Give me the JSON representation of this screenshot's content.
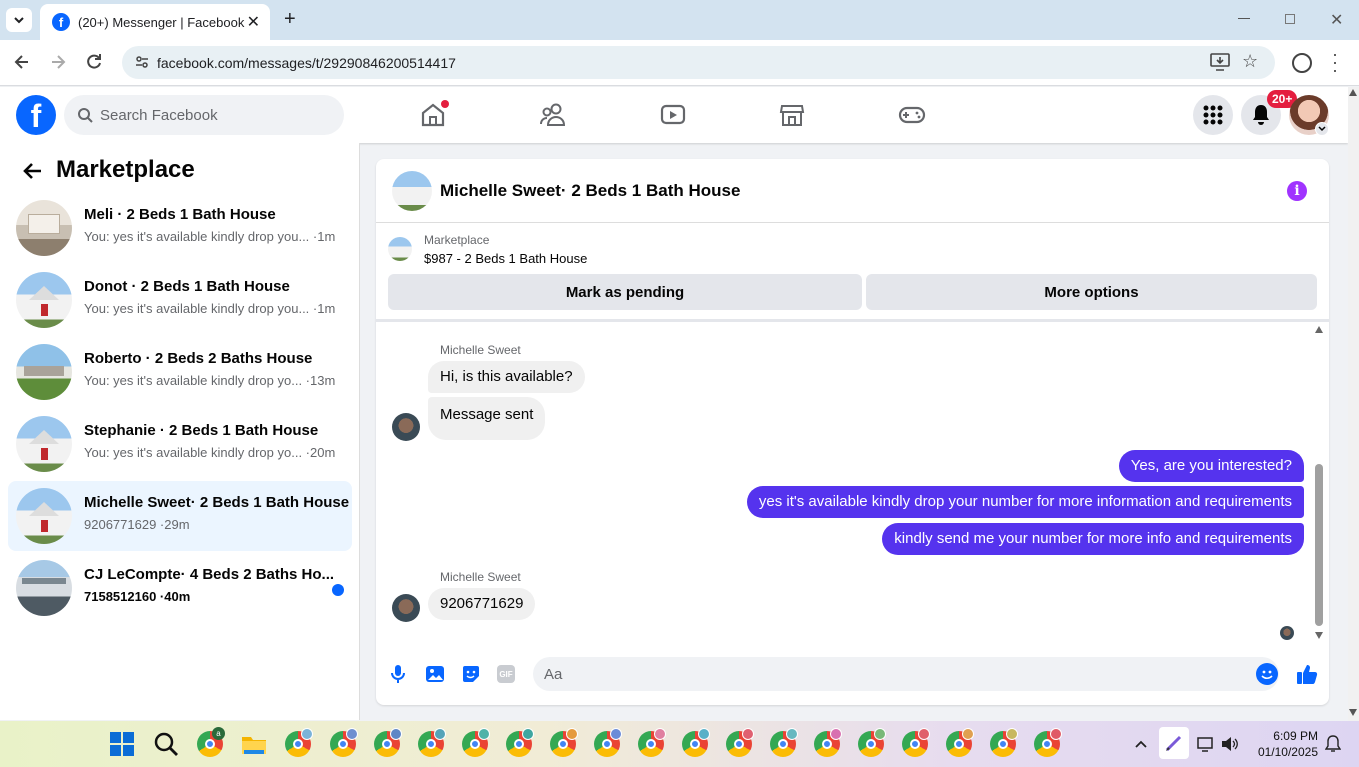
{
  "browser": {
    "tab_title": "(20+) Messenger | Facebook",
    "url": "facebook.com/messages/t/29290846200514417"
  },
  "fb": {
    "search_placeholder": "Search Facebook",
    "notif_badge": "20+"
  },
  "sidebar": {
    "title": "Marketplace",
    "conversations": [
      {
        "name": "Meli · 2 Beds 1 Bath House",
        "snippet": "You: yes it's available kindly drop you... ·1m"
      },
      {
        "name": "Donot · 2 Beds 1 Bath House",
        "snippet": "You: yes it's available kindly drop you... ·1m"
      },
      {
        "name": "Roberto · 2 Beds 2 Baths House",
        "snippet": "You: yes it's available kindly drop yo... ·13m"
      },
      {
        "name": "Stephanie · 2 Beds 1 Bath House",
        "snippet": "You: yes it's available kindly drop yo... ·20m"
      },
      {
        "name": "Michelle Sweet· 2 Beds 1 Bath House",
        "snippet": "9206771629 ·29m"
      },
      {
        "name": "CJ LeCompte· 4 Beds 2 Baths Ho...",
        "snippet": "7158512160 ·40m"
      }
    ]
  },
  "chat": {
    "title": "Michelle Sweet· 2 Beds 1 Bath House",
    "listing_label": "Marketplace",
    "listing_title": "$987 - 2 Beds 1 Bath House",
    "mark_pending": "Mark as pending",
    "more_options": "More options",
    "sender1": "Michelle Sweet",
    "msg_in_1": "Hi, is this available?",
    "msg_in_2": "Message sent",
    "msg_out_1": "Yes, are you interested?",
    "msg_out_2": "yes it's available kindly drop your number for more information and requirements",
    "msg_out_3": "kindly send me your number for more info and requirements",
    "sender2": "Michelle Sweet",
    "msg_in_3": "9206771629",
    "composer_placeholder": "Aa",
    "gif_label": "GIF"
  },
  "taskbar": {
    "time": "6:09 PM",
    "date": "01/10/2025"
  },
  "colors": {
    "fb_blue": "#0866ff",
    "outgoing_bubble": "#5533ee",
    "info_purple": "#a033ff",
    "badge_red": "#e41e3f"
  }
}
